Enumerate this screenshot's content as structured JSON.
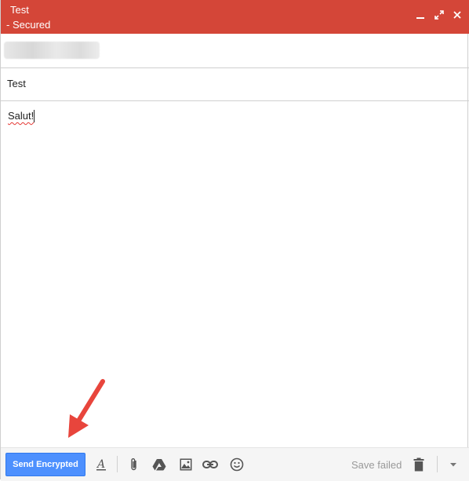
{
  "titlebar": {
    "title": "Test",
    "subtitle": "- Secured",
    "minimize_icon": "minimize-icon",
    "popout_icon": "pop-out-icon",
    "close_icon": "close-icon",
    "color": "#d44638"
  },
  "recipient": {
    "chip": "blurred recipient"
  },
  "subject": {
    "value": "Test"
  },
  "body": {
    "text": "Salut!"
  },
  "annotation": {
    "arrow_color": "#e8453c"
  },
  "toolbar": {
    "send_label": "Send Encrypted",
    "send_color": "#4d90fe",
    "icons": [
      "formatting-icon",
      "attach-icon",
      "drive-icon",
      "insert-photo-icon",
      "insert-link-icon",
      "emoji-icon",
      "trash-icon",
      "more-options-icon"
    ],
    "save_status": "Save failed"
  }
}
